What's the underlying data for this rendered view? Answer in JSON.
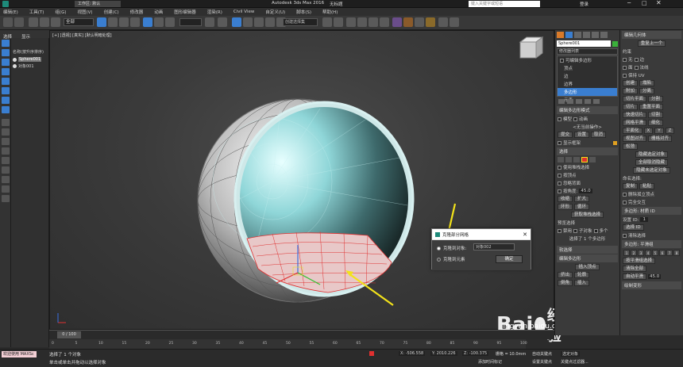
{
  "app": {
    "title": "Autodesk 3ds Max 2016",
    "doc": "无标题",
    "workspace": "工作区: 默认",
    "search_placeholder": "键入关键字或短语",
    "user": "登录"
  },
  "menu": [
    "编辑(E)",
    "工具(T)",
    "组(G)",
    "视图(V)",
    "创建(C)",
    "修改器",
    "动画",
    "图形编辑器",
    "渲染(R)",
    "Civil View",
    "自定义(U)",
    "脚本(S)",
    "帮助(H)"
  ],
  "toolbar": {
    "filter": "全部",
    "selset": "创建选择集"
  },
  "explorer": {
    "tabs": [
      "选择",
      "显示"
    ],
    "header": "名称(按升序排序)",
    "items": [
      "Sphere001",
      "对象001"
    ]
  },
  "viewport": {
    "label": "[+] [透视] [真实] [默认明暗处理]"
  },
  "dialog": {
    "title": "克隆部分网格",
    "opt_object": "克隆到对象:",
    "opt_element": "克隆到元素",
    "name_value": "对象002",
    "ok": "确定"
  },
  "cmd": {
    "object_name": "Sphere001",
    "modlist_label": "修改器列表",
    "stack": [
      "可编辑多边形",
      "顶点",
      "边",
      "边界",
      "多边形",
      "元素",
      "Sphere"
    ],
    "rollout_edit_mode": "编辑多边形模式",
    "model": "模型",
    "anim": "动画",
    "noop": "<无当前操作>",
    "commit": "提交",
    "settings": "设置",
    "cancel": "取消",
    "show_cage": "显示框架",
    "rollout_select": "选择",
    "by_vertex": "使用堆栈选择",
    "by_angle": "按顶点",
    "ignore_back": "忽略背面",
    "by_angle2": "按角度:",
    "angle_val": "45.0",
    "shrink": "收缩",
    "grow": "扩大",
    "ring": "环形",
    "loop": "循环",
    "get_stack": "获取堆栈选择",
    "preview": "预览选择",
    "off": "禁用",
    "subobj": "子对象",
    "multi": "多个",
    "selected": "选择了 1 个多边形",
    "soft_sel": "软选择",
    "edit_poly_roll": "编辑多边形",
    "insert_vertex": "插入顶点",
    "extrude": "挤出",
    "outline": "轮廓",
    "bevel": "倒角",
    "inset": "插入"
  },
  "right": {
    "edit_geom": "编辑几何体",
    "repeat": "重复上一个",
    "constraints": "约束",
    "none": "无",
    "edge": "边",
    "face": "面",
    "normal": "法线",
    "preserve_uv": "保持 UV",
    "create": "创建",
    "collapse": "塌陷",
    "attach": "附加",
    "detach": "分离",
    "slice_plane": "切片平面",
    "split": "分割",
    "slice": "切片",
    "reset_plane": "重置平面",
    "quickslice": "快速切片",
    "cut": "切割",
    "meshsmooth": "网格平滑",
    "tessellate": "细化",
    "make_planar": "平面化",
    "x": "X",
    "y": "Y",
    "z": "Z",
    "view_align": "视图对齐",
    "grid_align": "栅格对齐",
    "relax": "松弛",
    "hide_sel": "隐藏选定对象",
    "unhide_all": "全部取消隐藏",
    "hide_unsel": "隐藏未选定对象",
    "named_sel": "命名选择:",
    "copy": "复制",
    "paste": "粘贴",
    "delete_iso": "删除孤立顶点",
    "full_interact": "完全交互",
    "poly_mat": "多边形: 材质 ID",
    "set_id": "设置 ID:",
    "set_id_val": "1",
    "select_id": "选择 ID",
    "clear_sel": "清除选择",
    "poly_smooth": "多边形: 平滑组",
    "sg": [
      "1",
      "2",
      "3",
      "4",
      "5",
      "6",
      "7",
      "8",
      "9",
      "10",
      "11",
      "12",
      "13",
      "14",
      "15",
      "16",
      "17",
      "18",
      "19",
      "20",
      "21",
      "22",
      "23",
      "24",
      "25",
      "26",
      "27",
      "28",
      "29",
      "30",
      "31",
      "32"
    ],
    "select_by_sg": "按平滑组选择",
    "clear_all": "清除全部",
    "autosmooth": "自动平滑",
    "autosmooth_val": "45.0",
    "paint_deform": "绘制变形"
  },
  "timeline": {
    "frame": "0 / 100",
    "ticks": [
      "0",
      "5",
      "10",
      "15",
      "20",
      "25",
      "30",
      "35",
      "40",
      "45",
      "50",
      "55",
      "60",
      "65",
      "70",
      "75",
      "80",
      "85",
      "90",
      "95",
      "100"
    ]
  },
  "status": {
    "maxscript": "欢迎使用 MAXSc",
    "selected": "选择了 1 个对象",
    "hint": "单击或单击并拖动以选择对象",
    "x": "X: -506.558",
    "y": "Y: 2010.226",
    "z": "Z: -100.375",
    "grid": "栅格 = 10.0mm",
    "autokey": "自动关键点",
    "setkey": "设置关键点",
    "selected_obj": "选定对象",
    "keyfilter": "关键点过滤器...",
    "add_time": "添加时间标记"
  },
  "watermark": {
    "brand": "Bai",
    "brand2": "经验",
    "url": "jingyan.baidu.com"
  },
  "colors": {
    "accent": "#3a7ed0",
    "dialog_bg": "#f0f0f0",
    "arrow": "#f2e21a",
    "wire": "#e03030"
  }
}
